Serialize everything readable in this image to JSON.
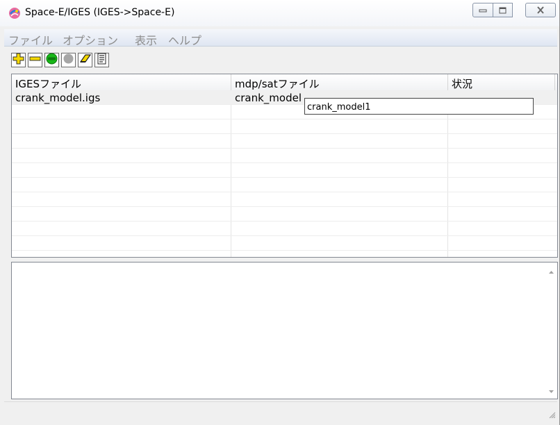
{
  "window": {
    "title": "Space-E/IGES (IGES->Space-E)",
    "app_icon": "space-e-app-icon",
    "caption_buttons": [
      "minimize-icon",
      "maximize-icon",
      "close-icon"
    ]
  },
  "menu": {
    "items": [
      {
        "label": "ファイル"
      },
      {
        "label": "オプション"
      },
      {
        "label": "表示"
      },
      {
        "label": "ヘルプ"
      }
    ],
    "disabled_text_color": "#8c8c8c"
  },
  "toolbar": {
    "buttons": [
      {
        "icon": "add-icon",
        "color": "#f5d800"
      },
      {
        "icon": "remove-icon",
        "color": "#f5d800"
      },
      {
        "icon": "go-icon",
        "color": "#18b818"
      },
      {
        "icon": "stop-icon",
        "color": "#a6a6a6"
      },
      {
        "icon": "eraser-icon",
        "color": "#f5d800"
      },
      {
        "icon": "document-icon",
        "color": "#333333"
      }
    ]
  },
  "table": {
    "columns": [
      "IGESファイル",
      "mdp/satファイル",
      "状況"
    ],
    "rows": [
      {
        "iges": "crank_model.igs",
        "mdp": "crank_model",
        "status": ""
      }
    ],
    "empty_row_count": 10,
    "edit_value": "crank_model1"
  },
  "log": {
    "text": "",
    "scroll_icons": [
      "scroll-up-arrow-icon",
      "scroll-down-arrow-icon"
    ]
  },
  "statusbar": {
    "text": "",
    "grip_icon": "resize-grip-icon"
  }
}
